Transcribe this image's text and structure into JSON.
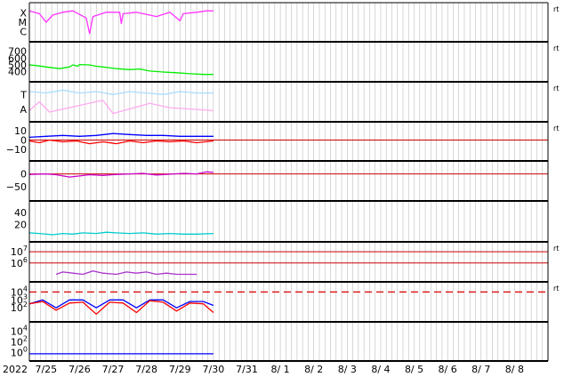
{
  "chart_data": {
    "type": "line",
    "x_start_label": "2022",
    "x_tick_labels": [
      "7/25",
      "7/26",
      "7/27",
      "7/28",
      "7/29",
      "7/30",
      "7/31",
      "8/ 1",
      "8/ 2",
      "8/ 3",
      "8/ 4",
      "8/ 5",
      "8/ 6",
      "8/ 7",
      "8/ 8"
    ],
    "x_range_days": [
      0,
      15.5
    ],
    "data_end_day": 5.5,
    "side_marker": "rt",
    "panels": [
      {
        "id": "xray",
        "y_labels": [
          "X",
          "M",
          "C"
        ],
        "series": [
          {
            "color": "#ff33ff",
            "points": [
              [
                0.0,
                0.1
              ],
              [
                0.3,
                0.2
              ],
              [
                0.5,
                0.5
              ],
              [
                0.7,
                0.25
              ],
              [
                1.0,
                0.15
              ],
              [
                1.3,
                0.1
              ],
              [
                1.7,
                0.35
              ],
              [
                1.8,
                0.9
              ],
              [
                1.9,
                0.3
              ],
              [
                2.3,
                0.15
              ],
              [
                2.7,
                0.15
              ],
              [
                2.75,
                0.55
              ],
              [
                2.8,
                0.2
              ],
              [
                3.2,
                0.15
              ],
              [
                3.8,
                0.3
              ],
              [
                4.2,
                0.15
              ],
              [
                4.5,
                0.45
              ],
              [
                4.6,
                0.2
              ],
              [
                5.0,
                0.15
              ],
              [
                5.3,
                0.1
              ],
              [
                5.5,
                0.1
              ]
            ]
          }
        ]
      },
      {
        "id": "solar-wind-speed",
        "y_ticks": [
          400,
          500,
          600,
          700
        ],
        "y_range": [
          330,
          760
        ],
        "series": [
          {
            "color": "#00ee00",
            "points": [
              [
                0.0,
                500
              ],
              [
                0.2,
                490
              ],
              [
                0.5,
                470
              ],
              [
                0.9,
                445
              ],
              [
                1.2,
                470
              ],
              [
                1.3,
                500
              ],
              [
                1.45,
                480
              ],
              [
                1.5,
                505
              ],
              [
                1.8,
                500
              ],
              [
                2.0,
                480
              ],
              [
                2.2,
                470
              ],
              [
                2.6,
                445
              ],
              [
                3.0,
                430
              ],
              [
                3.3,
                440
              ],
              [
                3.6,
                410
              ],
              [
                4.0,
                395
              ],
              [
                4.4,
                385
              ],
              [
                4.8,
                370
              ],
              [
                5.2,
                360
              ],
              [
                5.5,
                360
              ]
            ]
          }
        ]
      },
      {
        "id": "imf-direction",
        "y_labels": [
          "T",
          "A"
        ],
        "series": [
          {
            "color": "#aaddff",
            "points": [
              [
                0.0,
                0.15
              ],
              [
                0.5,
                0.2
              ],
              [
                1.0,
                0.1
              ],
              [
                1.5,
                0.2
              ],
              [
                2.0,
                0.15
              ],
              [
                2.5,
                0.25
              ],
              [
                3.0,
                0.15
              ],
              [
                3.5,
                0.2
              ],
              [
                4.0,
                0.25
              ],
              [
                4.5,
                0.15
              ],
              [
                5.0,
                0.2
              ],
              [
                5.5,
                0.2
              ]
            ]
          },
          {
            "color": "#ffaaee",
            "points": [
              [
                0.0,
                0.8
              ],
              [
                0.3,
                0.5
              ],
              [
                0.6,
                0.85
              ],
              [
                2.2,
                0.45
              ],
              [
                2.5,
                0.9
              ],
              [
                3.6,
                0.55
              ],
              [
                4.2,
                0.7
              ],
              [
                5.5,
                0.8
              ]
            ]
          }
        ]
      },
      {
        "id": "imf-bz",
        "y_ticks": [
          10,
          0,
          -10
        ],
        "y_range": [
          -17,
          14
        ],
        "zero_line": true,
        "series": [
          {
            "color": "#0000ff",
            "points": [
              [
                0.0,
                3
              ],
              [
                0.5,
                4
              ],
              [
                1.0,
                5
              ],
              [
                1.5,
                4
              ],
              [
                2.0,
                5
              ],
              [
                2.5,
                7
              ],
              [
                3.0,
                6
              ],
              [
                3.5,
                5
              ],
              [
                4.0,
                5
              ],
              [
                4.5,
                4
              ],
              [
                5.0,
                4
              ],
              [
                5.5,
                4
              ]
            ]
          },
          {
            "color": "#ff0000",
            "points": [
              [
                0.0,
                -1
              ],
              [
                0.3,
                -3
              ],
              [
                0.6,
                0
              ],
              [
                1.0,
                -2
              ],
              [
                1.4,
                -1
              ],
              [
                1.8,
                -4
              ],
              [
                2.2,
                -2
              ],
              [
                2.6,
                -4
              ],
              [
                3.0,
                -1
              ],
              [
                3.4,
                -3
              ],
              [
                3.8,
                -1
              ],
              [
                4.2,
                -2
              ],
              [
                4.6,
                -1
              ],
              [
                5.0,
                -3
              ],
              [
                5.5,
                -1
              ]
            ]
          }
        ]
      },
      {
        "id": "dst",
        "y_ticks": [
          0,
          -50
        ],
        "y_range": [
          -85,
          30
        ],
        "zero_line": true,
        "series": [
          {
            "color": "#cc00cc",
            "points": [
              [
                0.0,
                -2
              ],
              [
                0.5,
                0
              ],
              [
                0.8,
                -3
              ],
              [
                1.2,
                -12
              ],
              [
                1.5,
                -8
              ],
              [
                1.8,
                -3
              ],
              [
                2.2,
                -6
              ],
              [
                2.6,
                -2
              ],
              [
                3.0,
                0
              ],
              [
                3.4,
                2
              ],
              [
                3.8,
                -4
              ],
              [
                4.2,
                -1
              ],
              [
                4.6,
                2
              ],
              [
                5.0,
                0
              ],
              [
                5.3,
                8
              ],
              [
                5.5,
                6
              ]
            ]
          }
        ]
      },
      {
        "id": "kp-ae",
        "y_ticks": [
          20,
          40
        ],
        "y_range": [
          0,
          50
        ],
        "series": [
          {
            "color": "#00cccc",
            "points": [
              [
                0.0,
                6
              ],
              [
                0.3,
                5
              ],
              [
                0.7,
                3
              ],
              [
                1.0,
                5
              ],
              [
                1.3,
                4
              ],
              [
                1.6,
                6
              ],
              [
                2.0,
                5
              ],
              [
                2.3,
                7
              ],
              [
                2.6,
                6
              ],
              [
                3.0,
                5
              ],
              [
                3.4,
                6
              ],
              [
                3.8,
                4
              ],
              [
                4.2,
                5
              ],
              [
                4.6,
                4
              ],
              [
                5.0,
                4
              ],
              [
                5.5,
                5
              ]
            ]
          }
        ]
      },
      {
        "id": "proton-flux",
        "y_ticks_exp": [
          6,
          7
        ],
        "y_range_log": [
          4.8,
          7.4
        ],
        "ref_lines_exp": [
          6,
          7
        ],
        "series": [
          {
            "color": "#aa33cc",
            "points": [
              [
                0.8,
                5.0
              ],
              [
                1.0,
                5.2
              ],
              [
                1.3,
                5.1
              ],
              [
                1.6,
                5.0
              ],
              [
                1.9,
                5.3
              ],
              [
                2.2,
                5.1
              ],
              [
                2.6,
                5.0
              ],
              [
                2.9,
                5.2
              ],
              [
                3.2,
                5.1
              ],
              [
                3.5,
                5.2
              ],
              [
                3.8,
                5.0
              ],
              [
                4.1,
                5.1
              ],
              [
                4.4,
                5.0
              ],
              [
                5.0,
                5.0
              ]
            ]
          }
        ]
      },
      {
        "id": "electron-flux",
        "y_ticks_exp": [
          2,
          3,
          4
        ],
        "y_range_log": [
          0.9,
          4.6
        ],
        "dashed_ref_exp": 4,
        "series": [
          {
            "color": "#0000ff",
            "points": [
              [
                0.0,
                2.5
              ],
              [
                0.4,
                3.0
              ],
              [
                0.8,
                2.0
              ],
              [
                1.2,
                3.0
              ],
              [
                1.6,
                3.0
              ],
              [
                2.0,
                2.0
              ],
              [
                2.4,
                3.0
              ],
              [
                2.8,
                3.0
              ],
              [
                3.2,
                2.0
              ],
              [
                3.6,
                3.0
              ],
              [
                4.0,
                3.0
              ],
              [
                4.4,
                2.0
              ],
              [
                4.8,
                2.8
              ],
              [
                5.2,
                2.8
              ],
              [
                5.5,
                2.3
              ]
            ]
          },
          {
            "color": "#ff0000",
            "points": [
              [
                0.0,
                2.5
              ],
              [
                0.4,
                2.8
              ],
              [
                0.8,
                1.7
              ],
              [
                1.2,
                2.6
              ],
              [
                1.6,
                2.7
              ],
              [
                2.0,
                1.2
              ],
              [
                2.4,
                2.7
              ],
              [
                2.8,
                2.6
              ],
              [
                3.2,
                1.4
              ],
              [
                3.6,
                2.9
              ],
              [
                4.0,
                2.7
              ],
              [
                4.4,
                1.6
              ],
              [
                4.8,
                2.6
              ],
              [
                5.2,
                2.5
              ],
              [
                5.5,
                1.4
              ]
            ]
          }
        ]
      },
      {
        "id": "neutron",
        "y_ticks_exp": [
          0,
          2,
          4
        ],
        "y_range_log": [
          -0.6,
          4.8
        ],
        "series": [
          {
            "color": "#0000ff",
            "points": [
              [
                0.0,
                -0.25
              ],
              [
                1.0,
                -0.25
              ],
              [
                2.0,
                -0.25
              ],
              [
                3.0,
                -0.25
              ],
              [
                4.0,
                -0.25
              ],
              [
                5.5,
                -0.25
              ]
            ]
          }
        ]
      }
    ]
  }
}
